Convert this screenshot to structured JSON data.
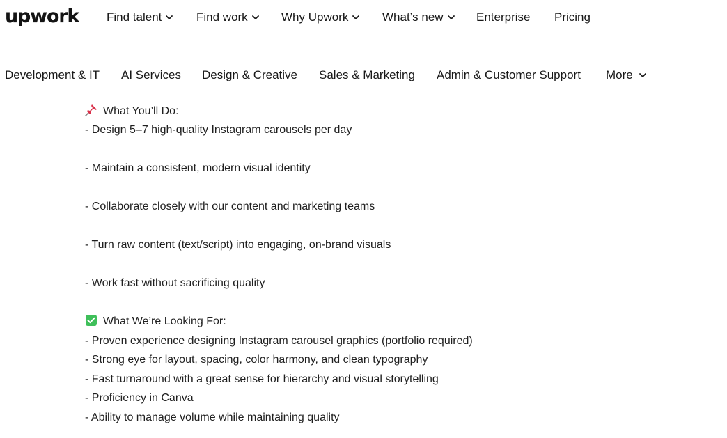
{
  "header": {
    "logo_text": "upwork",
    "nav": [
      {
        "label": "Find talent",
        "has_dropdown": true
      },
      {
        "label": "Find work",
        "has_dropdown": true
      },
      {
        "label": "Why Upwork",
        "has_dropdown": true
      },
      {
        "label": "What’s new",
        "has_dropdown": true
      },
      {
        "label": "Enterprise",
        "has_dropdown": false
      },
      {
        "label": "Pricing",
        "has_dropdown": false
      }
    ]
  },
  "categories": {
    "items": [
      {
        "label": "Development & IT"
      },
      {
        "label": "AI Services"
      },
      {
        "label": "Design & Creative"
      },
      {
        "label": "Sales & Marketing"
      },
      {
        "label": "Admin & Customer Support"
      }
    ],
    "more_label": "More"
  },
  "content": {
    "section1_icon": "pushpin-icon",
    "section1_heading": "What You’ll Do:",
    "section1_items": [
      "- Design 5–7 high-quality Instagram carousels per day",
      "- Maintain a consistent, modern visual identity",
      "- Collaborate closely with our content and marketing teams",
      "- Turn raw content (text/script) into engaging, on-brand visuals",
      "- Work fast without sacrificing quality"
    ],
    "section2_icon": "check-mark-button-icon",
    "section2_heading": "What We’re Looking For:",
    "section2_items": [
      "- Proven experience designing Instagram carousel graphics (portfolio required)",
      "- Strong eye for layout, spacing, color harmony, and clean typography",
      "- Fast turnaround with a great sense for hierarchy and visual storytelling",
      "- Proficiency in Canva",
      "- Ability to manage volume while maintaining quality"
    ]
  },
  "colors": {
    "text": "#181818",
    "border": "#e4ebe4",
    "pin_red": "#d9304a",
    "check_green": "#3fbf5a"
  }
}
